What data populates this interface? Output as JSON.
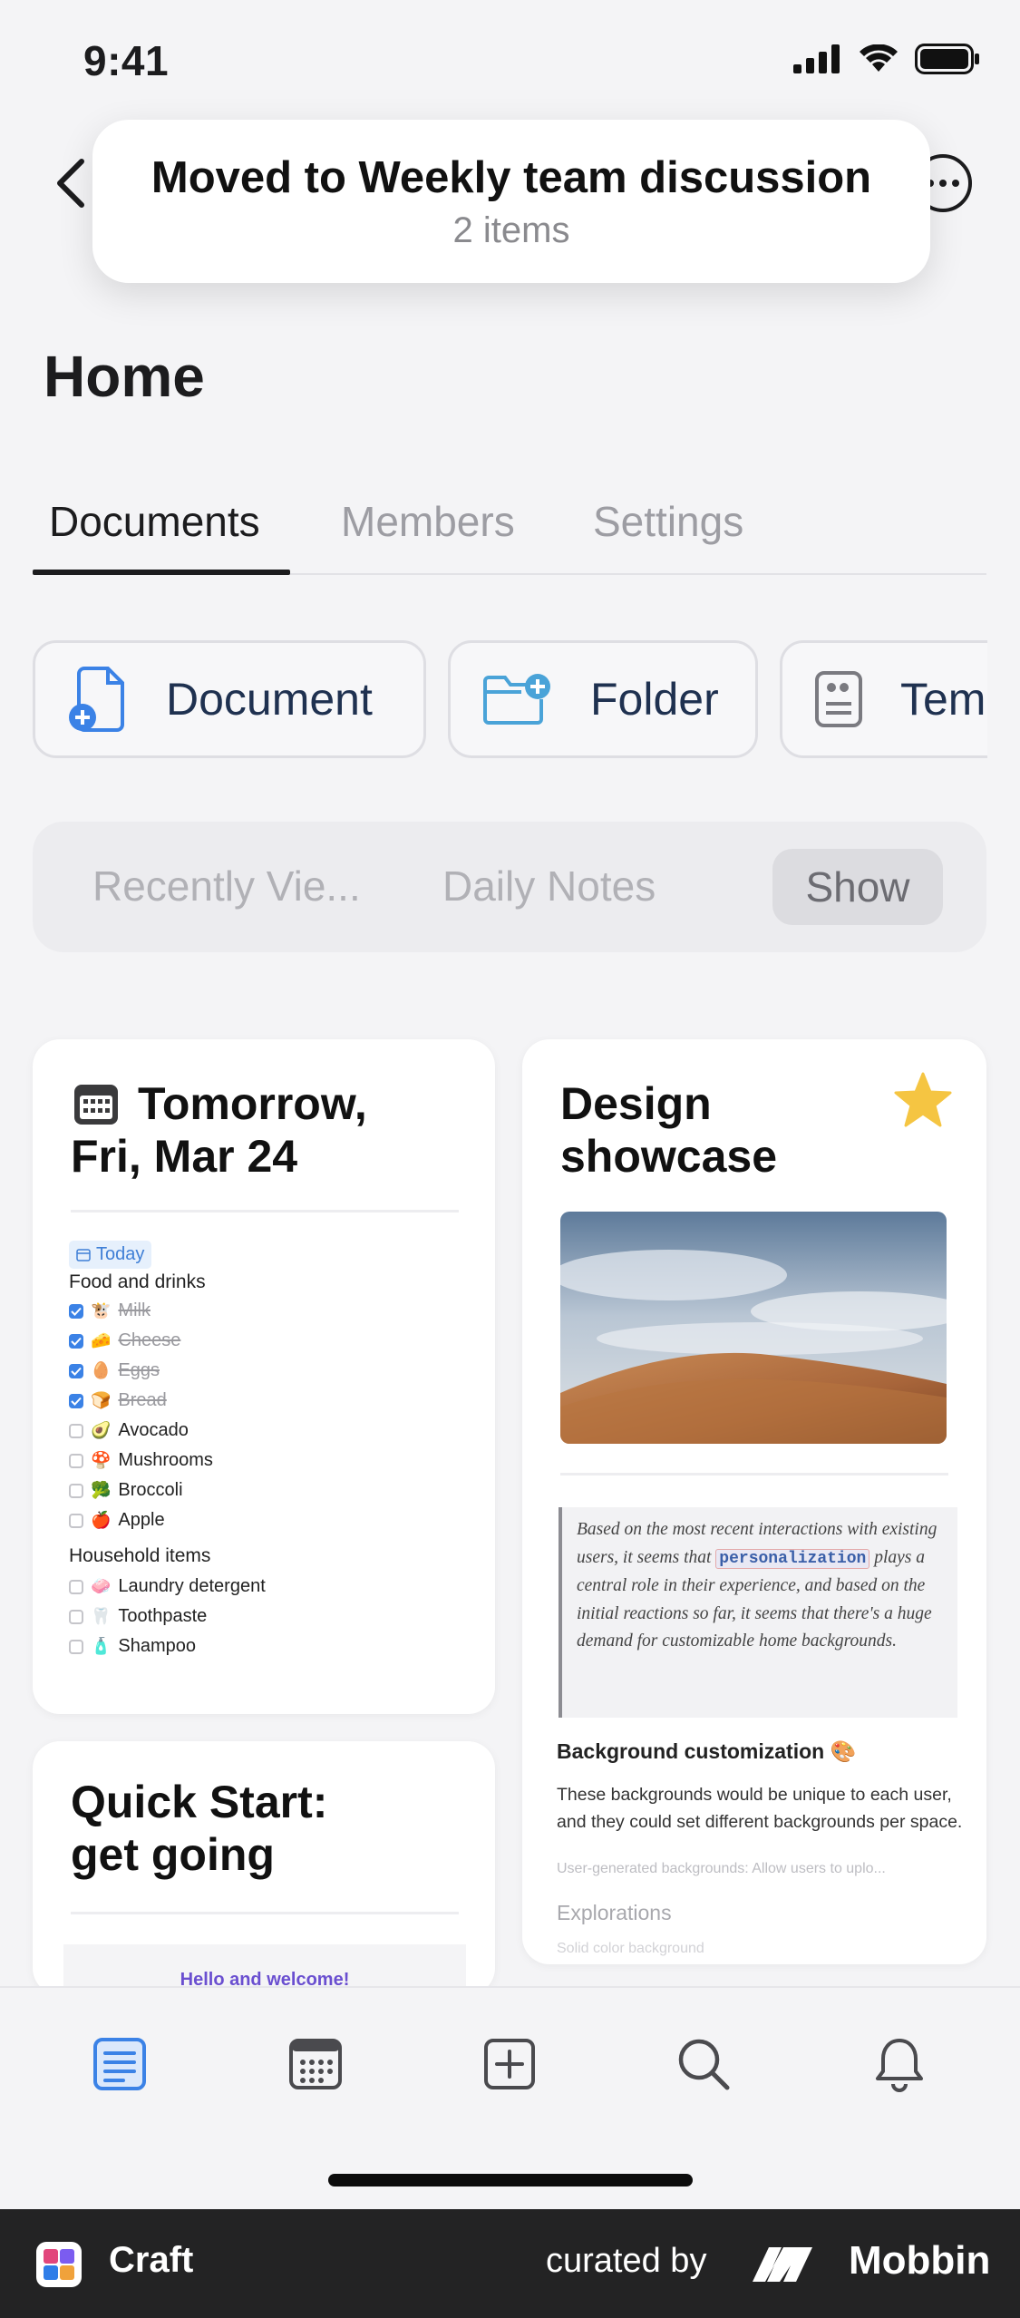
{
  "status_bar": {
    "time": "9:41"
  },
  "toast": {
    "title": "Moved to Weekly team discussion",
    "subtitle": "2 items"
  },
  "page": {
    "title": "Home"
  },
  "tabs": [
    {
      "label": "Documents",
      "active": true
    },
    {
      "label": "Members",
      "active": false
    },
    {
      "label": "Settings",
      "active": false
    }
  ],
  "create_buttons": [
    {
      "label": "Document",
      "icon": "new-document-icon"
    },
    {
      "label": "Folder",
      "icon": "new-folder-icon"
    },
    {
      "label": "Tem",
      "icon": "template-icon"
    }
  ],
  "segmented": {
    "items": [
      "Recently Vie...",
      "Daily Notes"
    ],
    "show_label": "Show"
  },
  "cards": {
    "daily": {
      "title_line1": "Tomorrow,",
      "title_line2": "Fri, Mar 24",
      "today_chip": "Today",
      "food_heading": "Food and drinks",
      "food_items": [
        {
          "emoji": "🐮",
          "label": "Milk",
          "checked": true
        },
        {
          "emoji": "🧀",
          "label": "Cheese",
          "checked": true
        },
        {
          "emoji": "🥚",
          "label": "Eggs",
          "checked": true
        },
        {
          "emoji": "🍞",
          "label": "Bread",
          "checked": true
        },
        {
          "emoji": "🥑",
          "label": "Avocado",
          "checked": false
        },
        {
          "emoji": "🍄",
          "label": "Mushrooms",
          "checked": false
        },
        {
          "emoji": "🥦",
          "label": "Broccoli",
          "checked": false
        },
        {
          "emoji": "🍎",
          "label": "Apple",
          "checked": false
        }
      ],
      "household_heading": "Household items",
      "household_items": [
        {
          "emoji": "🧼",
          "label": "Laundry detergent",
          "checked": false
        },
        {
          "emoji": "🦷",
          "label": "Toothpaste",
          "checked": false
        },
        {
          "emoji": "🧴",
          "label": "Shampoo",
          "checked": false
        }
      ]
    },
    "design": {
      "title_line1": "Design",
      "title_line2": "showcase",
      "quote_before": "Based on the most recent interactions with existing users, it seems that",
      "quote_code": "personalization",
      "quote_after": "plays a central role in their experience, and based on the initial reactions so far, it seems that there's a huge demand for customizable home backgrounds.",
      "bg_heading": "Background customization 🎨",
      "bg_body": "These backgrounds would be unique to each user, and they could set different backgrounds per space.",
      "bg_faint": "User-generated backgrounds: Allow users to uplo...",
      "explorations": "Explorations",
      "solid_faint": "Solid color background"
    },
    "quickstart": {
      "title_line1": "Quick Start:",
      "title_line2": "get going",
      "welcome": "Hello and welcome!"
    }
  },
  "tabbar": [
    "documents-icon",
    "calendar-icon",
    "add-icon",
    "search-icon",
    "bell-icon"
  ],
  "footer": {
    "app_name": "Craft",
    "curated": "curated by",
    "brand": "Mobbin"
  },
  "colors": {
    "accent": "#3b82e6",
    "star": "#f5c542",
    "folder": "#4aa3d8"
  }
}
